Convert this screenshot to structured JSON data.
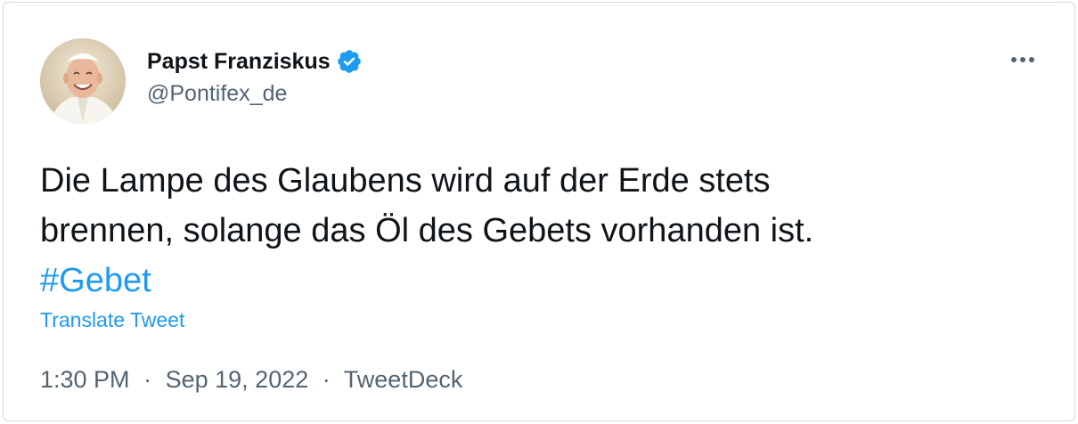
{
  "author": {
    "display_name": "Papst Franziskus",
    "handle": "@Pontifex_de",
    "verified": true,
    "avatar_icon": "profile-photo"
  },
  "more_icon": "more-horizontal-icon",
  "tweet": {
    "line1": "Die Lampe des Glaubens wird auf der Erde stets",
    "line2": "brennen, solange das Öl des Gebets vorhanden ist.",
    "hashtag": "#Gebet"
  },
  "translate_label": "Translate Tweet",
  "meta": {
    "time": "1:30 PM",
    "separator": "·",
    "date": "Sep 19, 2022",
    "source": "TweetDeck"
  },
  "colors": {
    "accent": "#1d9bf0",
    "text_primary": "#0f1419",
    "text_secondary": "#536471",
    "border": "#cfd9de"
  }
}
